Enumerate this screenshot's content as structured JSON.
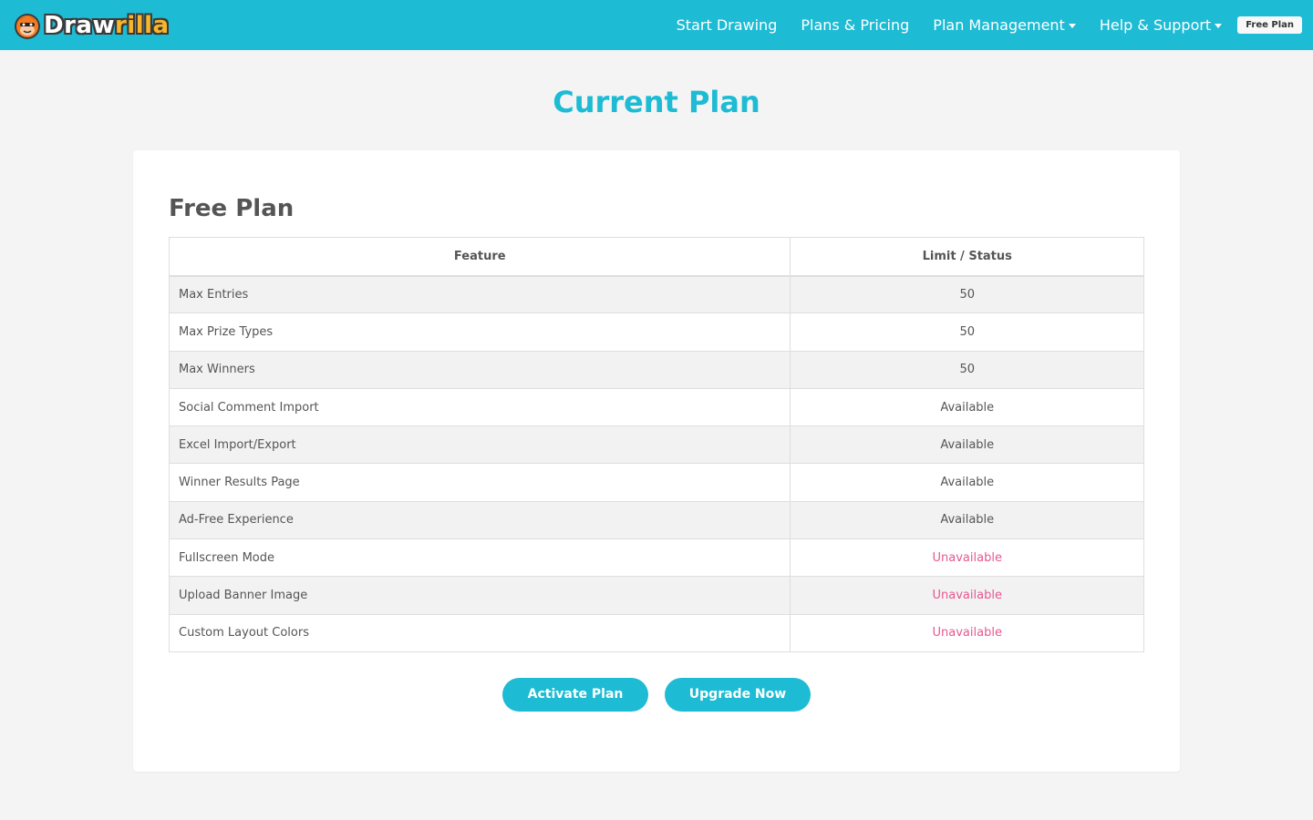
{
  "navbar": {
    "brand_part1": "Draw",
    "brand_part2": "rilla",
    "links": [
      {
        "label": "Start Drawing",
        "dropdown": false
      },
      {
        "label": "Plans & Pricing",
        "dropdown": false
      },
      {
        "label": "Plan Management",
        "dropdown": true
      },
      {
        "label": "Help & Support",
        "dropdown": true
      }
    ],
    "plan_badge": "Free Plan"
  },
  "main": {
    "title": "Current Plan",
    "plan_name": "Free Plan",
    "table": {
      "headers": [
        "Feature",
        "Limit / Status"
      ],
      "rows": [
        {
          "feature": "Max Entries",
          "status": "50"
        },
        {
          "feature": "Max Prize Types",
          "status": "50"
        },
        {
          "feature": "Max Winners",
          "status": "50"
        },
        {
          "feature": "Social Comment Import",
          "status": "Available"
        },
        {
          "feature": "Excel Import/Export",
          "status": "Available"
        },
        {
          "feature": "Winner Results Page",
          "status": "Available"
        },
        {
          "feature": "Ad-Free Experience",
          "status": "Available"
        },
        {
          "feature": "Fullscreen Mode",
          "status": "Unavailable"
        },
        {
          "feature": "Upload Banner Image",
          "status": "Unavailable"
        },
        {
          "feature": "Custom Layout Colors",
          "status": "Unavailable"
        }
      ]
    },
    "activate_label": "Activate Plan",
    "upgrade_label": "Upgrade Now"
  },
  "colors": {
    "accent": "#1dbbd4",
    "unavailable": "#e8578f",
    "brand_yellow": "#f7b52b"
  },
  "icons": {
    "logo": "gorilla-mascot-icon",
    "dropdown": "caret-down-icon"
  }
}
